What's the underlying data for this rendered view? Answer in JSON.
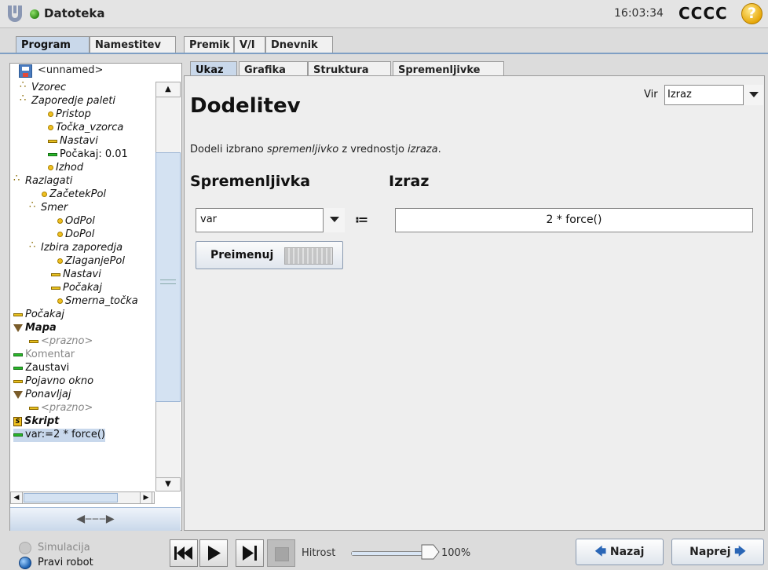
{
  "header": {
    "app_title": "Datoteka",
    "clock": "16:03:34",
    "robot_name": "CCCC",
    "help": "?"
  },
  "main_tabs": [
    "Program",
    "Namestitev",
    "Premik",
    "V/I",
    "Dnevnik"
  ],
  "active_main_tab": "Program",
  "file": {
    "name": "<unnamed>"
  },
  "tree": [
    {
      "label": "Vzorec",
      "icon": "sequence-icon",
      "style": "italic",
      "indent": 1
    },
    {
      "label": "Zaporedje paleti",
      "icon": "sequence-icon",
      "style": "italic",
      "indent": 1
    },
    {
      "label": "Pristop",
      "icon": "waypoint-icon",
      "style": "italic",
      "indent": 2
    },
    {
      "label": "Točka_vzorca",
      "icon": "waypoint-icon",
      "style": "italic",
      "indent": 2
    },
    {
      "label": "Nastavi",
      "icon": "set-icon",
      "style": "italic",
      "indent": 2
    },
    {
      "label": "Počakaj: 0.01",
      "icon": "wait-icon",
      "style": "normal",
      "indent": 2
    },
    {
      "label": "Izhod",
      "icon": "waypoint-icon",
      "style": "italic",
      "indent": 2
    },
    {
      "label": "Razlagati",
      "icon": "sequence-icon",
      "style": "italic",
      "indent": 0
    },
    {
      "label": "ZačetekPol",
      "icon": "waypoint-icon",
      "style": "italic",
      "indent": 1
    },
    {
      "label": "Smer",
      "icon": "sequence-icon",
      "style": "italic",
      "indent": 1
    },
    {
      "label": "OdPol",
      "icon": "waypoint-icon",
      "style": "italic",
      "indent": 2
    },
    {
      "label": "DoPol",
      "icon": "waypoint-icon",
      "style": "italic",
      "indent": 2
    },
    {
      "label": "Izbira zaporedja",
      "icon": "sequence-icon",
      "style": "italic",
      "indent": 1
    },
    {
      "label": "ZlaganjePol",
      "icon": "waypoint-icon",
      "style": "italic",
      "indent": 2
    },
    {
      "label": "Nastavi",
      "icon": "set-icon",
      "style": "italic",
      "indent": 2
    },
    {
      "label": "Počakaj",
      "icon": "set-icon",
      "style": "italic",
      "indent": 2
    },
    {
      "label": "Smerna_točka",
      "icon": "waypoint-icon",
      "style": "italic",
      "indent": 2
    },
    {
      "label": "Počakaj",
      "icon": "set-icon",
      "style": "italic",
      "indent": 0
    },
    {
      "label": "Mapa",
      "icon": "folder-icon",
      "style": "bold-italic",
      "indent": 0
    },
    {
      "label": "<prazno>",
      "icon": "set-icon",
      "style": "italic-gray",
      "indent": 1
    },
    {
      "label": "Komentar",
      "icon": "comment-icon",
      "style": "gray",
      "indent": 0
    },
    {
      "label": "Zaustavi",
      "icon": "halt-icon",
      "style": "normal",
      "indent": 0
    },
    {
      "label": "Pojavno okno",
      "icon": "set-icon",
      "style": "italic",
      "indent": 0
    },
    {
      "label": "Ponavljaj",
      "icon": "folder-icon",
      "style": "italic",
      "indent": 0
    },
    {
      "label": "<prazno>",
      "icon": "set-icon",
      "style": "italic-gray",
      "indent": 1
    },
    {
      "label": "Skript",
      "icon": "script-icon",
      "style": "bold-italic",
      "indent": 0
    },
    {
      "label": "var:=2 * force()",
      "icon": "assignment-icon",
      "style": "selected",
      "indent": 0
    }
  ],
  "sub_tabs": [
    "Ukaz",
    "Grafika",
    "Struktura",
    "Spremenljivke"
  ],
  "active_sub_tab": "Ukaz",
  "command": {
    "title": "Dodelitev",
    "source_label": "Vir",
    "source_value": "Izraz",
    "description_prefix": "Dodeli izbrano ",
    "description_var": "spremenljivko",
    "description_mid": " z vrednostjo ",
    "description_expr": "izraza",
    "description_suffix": ".",
    "var_heading": "Spremenljivka",
    "expr_heading": "Izraz",
    "var_value": "var",
    "assign_operator": "≔",
    "expression": "2 * force()",
    "rename_label": "Preimenuj"
  },
  "footer": {
    "simulation_label": "Simulacija",
    "real_robot_label": "Pravi robot",
    "speed_label": "Hitrost",
    "speed_value": "100%",
    "speed_fraction": 1.0,
    "back_label": "Nazaj",
    "next_label": "Naprej"
  },
  "colors": {
    "accent": "#c9d8ea",
    "status_green": "#2f8a16",
    "help_yellow": "#e5a300"
  }
}
